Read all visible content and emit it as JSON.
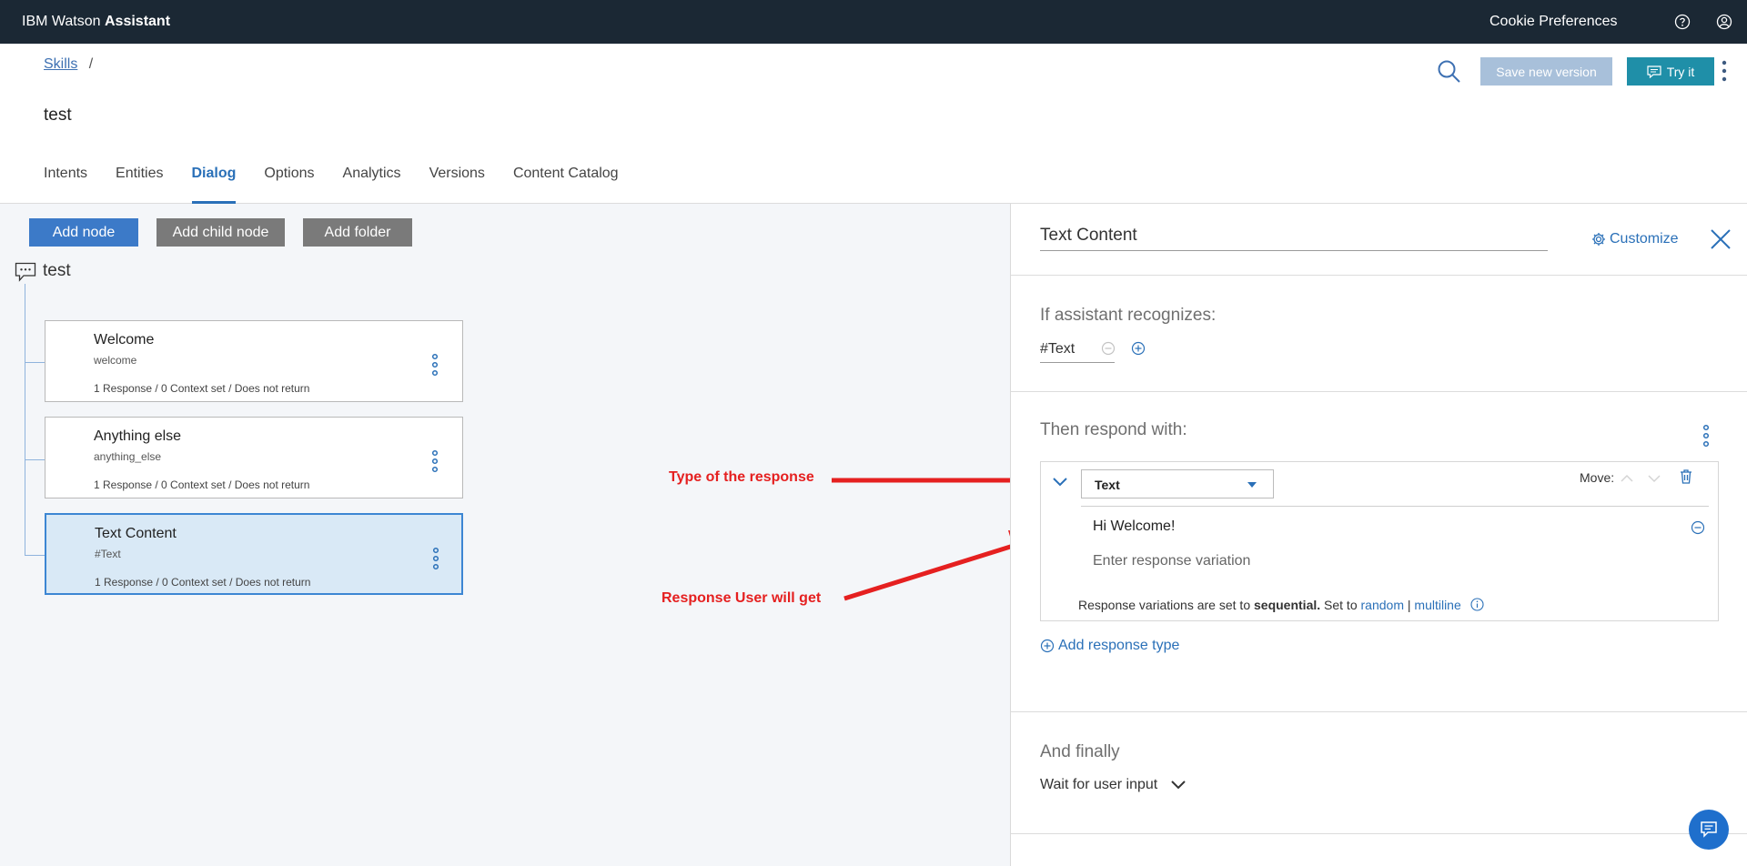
{
  "topbar": {
    "brand_regular": "IBM Watson",
    "brand_bold": "Assistant",
    "cookie_label": "Cookie Preferences",
    "help_icon": "help-icon",
    "user_icon": "user-icon"
  },
  "header": {
    "breadcrumb_link": "Skills",
    "breadcrumb_sep": "/",
    "skill_title": "test",
    "save_label": "Save new version",
    "try_label": "Try it",
    "tabs": [
      "Intents",
      "Entities",
      "Dialog",
      "Options",
      "Analytics",
      "Versions",
      "Content Catalog"
    ],
    "active_tab": "Dialog"
  },
  "dialog": {
    "add_node_label": "Add node",
    "add_child_label": "Add child node",
    "add_folder_label": "Add folder",
    "root_label": "test",
    "nodes": [
      {
        "title": "Welcome",
        "condition": "welcome",
        "meta": "1 Response / 0 Context set / Does not return"
      },
      {
        "title": "Anything else",
        "condition": "anything_else",
        "meta": "1 Response / 0 Context set / Does not return"
      },
      {
        "title": "Text Content",
        "condition": "#Text",
        "meta": "1 Response / 0 Context set / Does not return"
      }
    ],
    "selected_node": "Text Content"
  },
  "annotations": {
    "type_label": "Type of the response",
    "response_label": "Response User will get",
    "arrow_color": "#e52020"
  },
  "panel": {
    "node_name": "Text Content",
    "customize_label": "Customize",
    "recognizes_label": "If assistant recognizes:",
    "condition_value": "#Text",
    "respond_label": "Then respond with:",
    "response_type": "Text",
    "move_label": "Move:",
    "variation_value": "Hi Welcome!",
    "variation_placeholder": "Enter response variation",
    "settings_prefix": "Response variations are set to",
    "settings_mode": "sequential.",
    "settings_set_to": "Set to",
    "settings_random": "random",
    "settings_sep": "|",
    "settings_multiline": "multiline",
    "add_response_label": "Add response type",
    "finally_label": "And finally",
    "wait_label": "Wait for user input"
  },
  "colors": {
    "topbar": "#1b2834",
    "accent": "#2a70b8",
    "try_button": "#1f8fa8",
    "save_button_disabled": "#a8c0da"
  }
}
